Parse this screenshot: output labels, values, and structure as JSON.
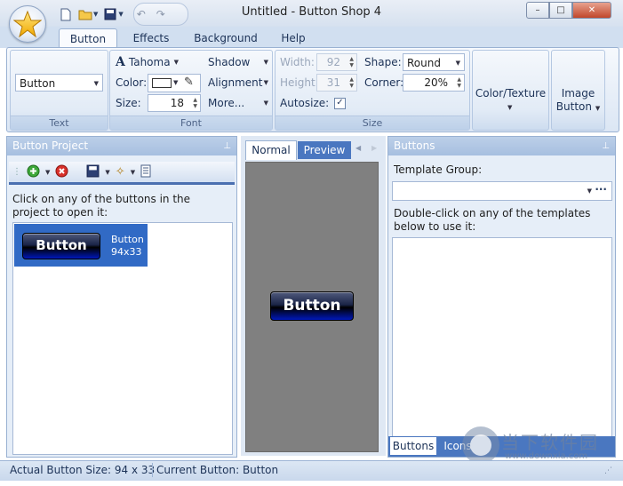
{
  "window": {
    "title": "Untitled - Button Shop 4",
    "minimize": "–",
    "maximize": "□",
    "close": "✕"
  },
  "tabs": [
    {
      "label": "Button"
    },
    {
      "label": "Effects"
    },
    {
      "label": "Background"
    },
    {
      "label": "Help"
    }
  ],
  "ribbon": {
    "text_group": {
      "label": "Text",
      "text_value": "Button"
    },
    "font_group": {
      "label": "Font",
      "font_name": "Tahoma",
      "color_label": "Color:",
      "size_label": "Size:",
      "size_value": "18",
      "shadow_label": "Shadow",
      "alignment_label": "Alignment",
      "more_label": "More..."
    },
    "size_group": {
      "label": "Size",
      "width_label": "Width:",
      "width_value": "92",
      "height_label": "Height:",
      "height_value": "31",
      "autosize_label": "Autosize:",
      "autosize_checked": "✓",
      "shape_label": "Shape:",
      "shape_value": "Round",
      "corner_label": "Corner:",
      "corner_value": "20%"
    },
    "color_texture_label": "Color/Texture",
    "image_button_label_1": "Image",
    "image_button_label_2": "Button"
  },
  "button_project": {
    "title": "Button Project",
    "instruction": "Click on any of the buttons in the project to open it:",
    "item": {
      "preview_text": "Button",
      "name": "Button",
      "size": "94x33"
    }
  },
  "preview": {
    "tab_normal": "Normal",
    "tab_preview": "Preview",
    "button_text": "Button"
  },
  "buttons_panel": {
    "title": "Buttons",
    "template_group_label": "Template Group:",
    "template_group_value": "",
    "browse": "···",
    "instruction": "Double-click on any of the templates below to use it:",
    "tab_buttons": "Buttons",
    "tab_icons": "Icons"
  },
  "status": {
    "actual_size": "Actual Button Size:  94 x 33",
    "current_button": "Current Button:  Button"
  },
  "watermark": {
    "name": "当下软件园",
    "url": "www.downxia.com"
  }
}
